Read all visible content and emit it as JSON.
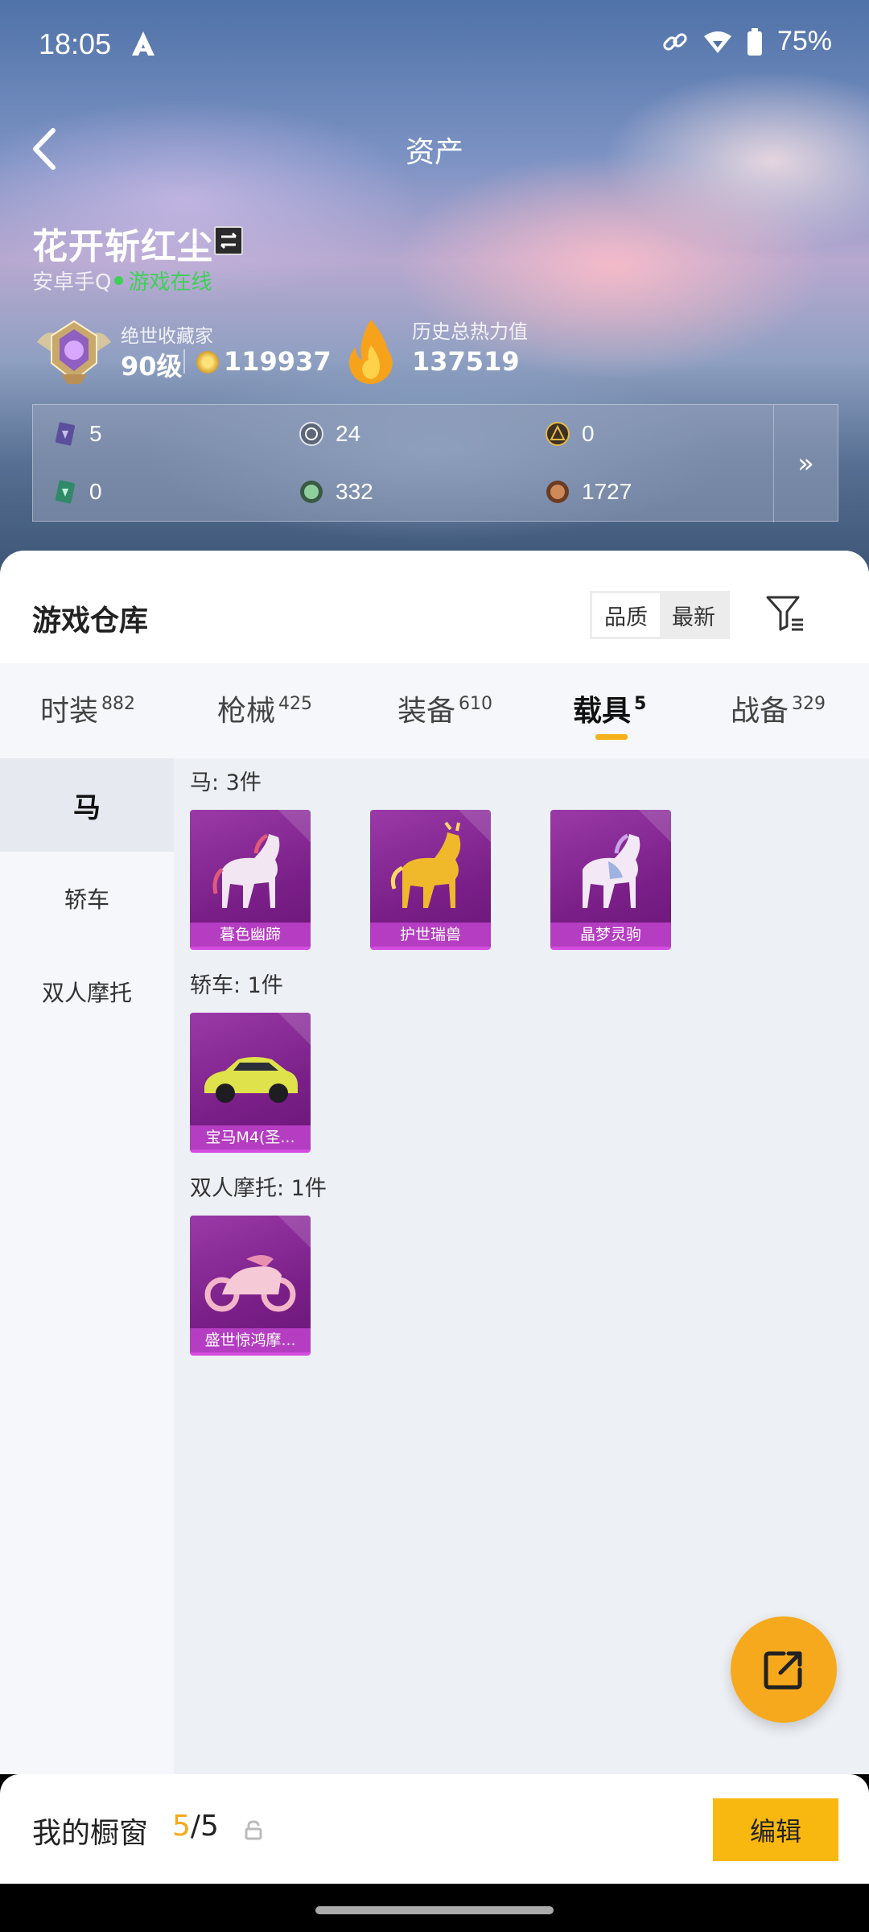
{
  "status_bar": {
    "time": "18:05",
    "battery": "75%"
  },
  "header": {
    "title": "资产",
    "back_icon": "chevron-left-icon"
  },
  "player": {
    "name": "花开斩红尘",
    "platform": "安卓手Q",
    "online_status": "游戏在线",
    "collector_title": "绝世收藏家",
    "level": "90级",
    "coins": "119937",
    "heat_label": "历史总热力值",
    "heat_value": "137519",
    "help": "?"
  },
  "stats": [
    {
      "icon": "ticket-card-icon",
      "value": "5"
    },
    {
      "icon": "silver-token-icon",
      "value": "24"
    },
    {
      "icon": "gold-token-icon",
      "value": "0"
    },
    {
      "icon": "green-card-icon",
      "value": "0"
    },
    {
      "icon": "green-coin-icon",
      "value": "332"
    },
    {
      "icon": "bronze-coin-icon",
      "value": "1727"
    }
  ],
  "stats_more": "»",
  "warehouse": {
    "title": "游戏仓库",
    "sort": {
      "quality": "品质",
      "newest": "最新",
      "active": "品质"
    }
  },
  "tabs": [
    {
      "label": "时装",
      "count": "882"
    },
    {
      "label": "枪械",
      "count": "425"
    },
    {
      "label": "装备",
      "count": "610"
    },
    {
      "label": "载具",
      "count": "5",
      "active": true
    },
    {
      "label": "战备",
      "count": "329"
    }
  ],
  "sidebar": [
    {
      "label": "马",
      "active": true
    },
    {
      "label": "轿车"
    },
    {
      "label": "双人摩托"
    }
  ],
  "sections": [
    {
      "title": "马: 3件",
      "items": [
        "暮色幽蹄",
        "护世瑞兽",
        "晶梦灵驹"
      ]
    },
    {
      "title": "轿车: 1件",
      "items": [
        "宝马M4(圣..."
      ]
    },
    {
      "title": "双人摩托: 1件",
      "items": [
        "盛世惊鸿摩..."
      ]
    }
  ],
  "showcase": {
    "label": "我的橱窗",
    "current": "5",
    "total": "/5",
    "edit": "编辑"
  },
  "colors": {
    "accent": "#f6a91c",
    "card_purple": "#8a2a98",
    "online": "#3fcf56"
  }
}
